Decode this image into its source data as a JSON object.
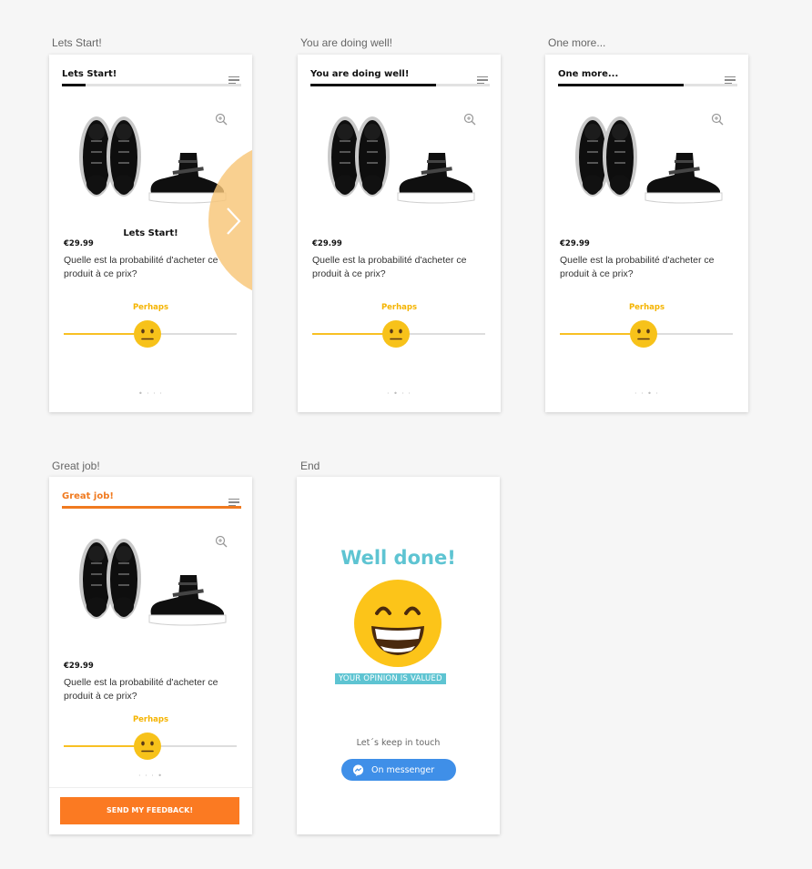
{
  "frames": [
    {
      "label": "Lets Start!",
      "title": "Lets Start!",
      "progress": 0.13,
      "price": "€29.99",
      "question": "Quelle est la probabilité d'acheter ce produit à ce prix?",
      "slider_label": "Perhaps",
      "slider_value": 0.48,
      "dots": "• · · ·",
      "overlay_text": "Lets Start!"
    },
    {
      "label": "You are doing well!",
      "title": "You are doing well!",
      "progress": 0.7,
      "price": "€29.99",
      "question": "Quelle est la probabilité d'acheter ce produit à ce prix?",
      "slider_label": "Perhaps",
      "slider_value": 0.48,
      "dots": "· • · ·"
    },
    {
      "label": "One more...",
      "title": "One more...",
      "progress": 0.7,
      "price": "€29.99",
      "question": "Quelle est la probabilité d'acheter ce produit à ce prix?",
      "slider_label": "Perhaps",
      "slider_value": 0.48,
      "dots": "· · • ·"
    },
    {
      "label": "Great job!",
      "title": "Great job!",
      "progress": 1.0,
      "price": "€29.99",
      "question": "Quelle est la probabilité d'acheter ce produit à ce prix?",
      "slider_label": "Perhaps",
      "slider_value": 0.48,
      "dots": "· · · •",
      "send_label": "SEND MY FEEDBACK!"
    }
  ],
  "end": {
    "label": "End",
    "title": "Well done!",
    "opinion": "YOUR OPINION IS VALUED",
    "keep_in_touch": "Let´s keep in touch",
    "messenger_label": "On messenger"
  },
  "colors": {
    "accent_orange": "#fb7a22",
    "slider_yellow": "#f8c023",
    "end_teal": "#5ec4d2",
    "messenger_blue": "#3f8fe8"
  },
  "icons": [
    "menu-icon",
    "zoom-in-icon",
    "neutral-face-icon",
    "chevron-right-icon",
    "grinning-face-icon",
    "messenger-icon"
  ]
}
